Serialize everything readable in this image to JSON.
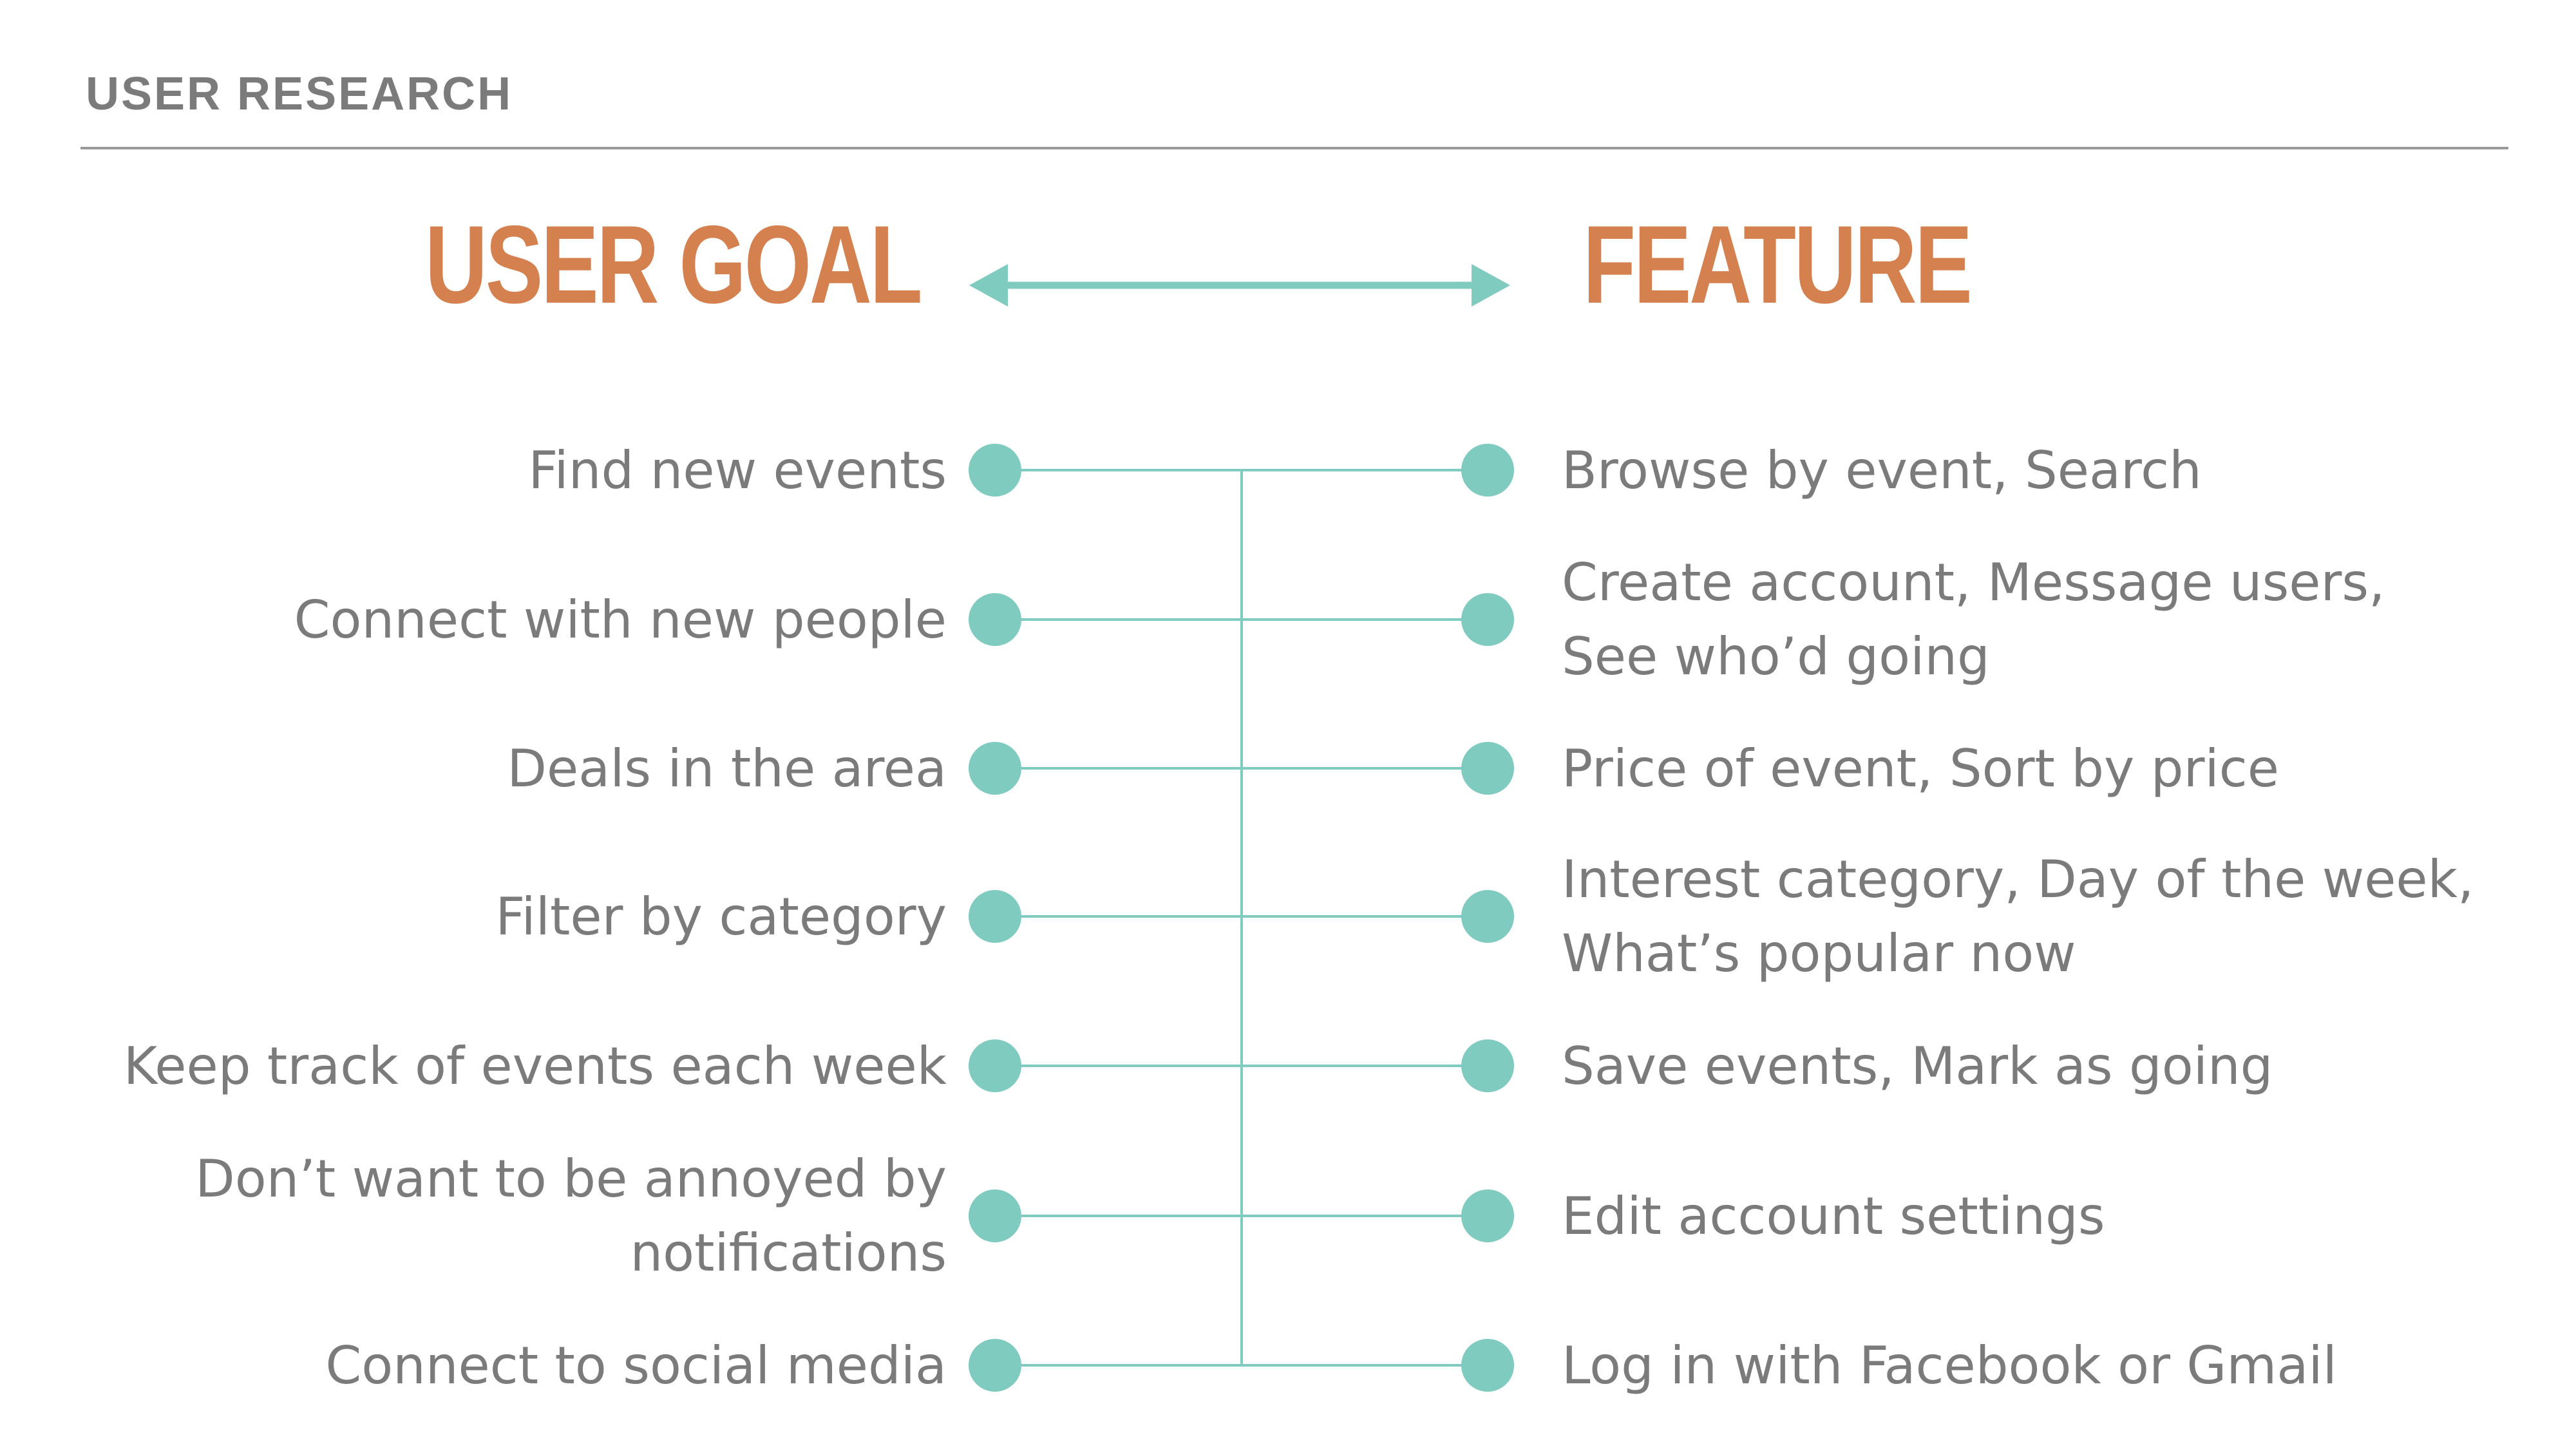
{
  "header": {
    "section_label": "USER RESEARCH"
  },
  "columns": {
    "left_heading": "USER GOAL",
    "right_heading": "FEATURE"
  },
  "colors": {
    "accent_teal": "#7fcbbf",
    "heading_orange": "#d5804f",
    "text_gray": "#7b7b7b"
  },
  "icons": {
    "arrow": "double-arrow-icon",
    "node": "dot-icon"
  },
  "rows": [
    {
      "goal": [
        "Find new events"
      ],
      "feature": [
        "Browse by event, Search"
      ]
    },
    {
      "goal": [
        "Connect with new people"
      ],
      "feature": [
        "Create account, Message users,",
        "See who’d going"
      ]
    },
    {
      "goal": [
        "Deals in the area"
      ],
      "feature": [
        "Price of event, Sort by price"
      ]
    },
    {
      "goal": [
        "Filter by category"
      ],
      "feature": [
        "Interest category, Day of the week,",
        "What’s popular now"
      ]
    },
    {
      "goal": [
        "Keep track of events each week"
      ],
      "feature": [
        "Save events, Mark as going"
      ]
    },
    {
      "goal": [
        "Don’t want to be annoyed by",
        "notifications"
      ],
      "feature": [
        "Edit account settings"
      ]
    },
    {
      "goal": [
        "Connect to social media"
      ],
      "feature": [
        "Log in with Facebook or Gmail"
      ]
    }
  ]
}
